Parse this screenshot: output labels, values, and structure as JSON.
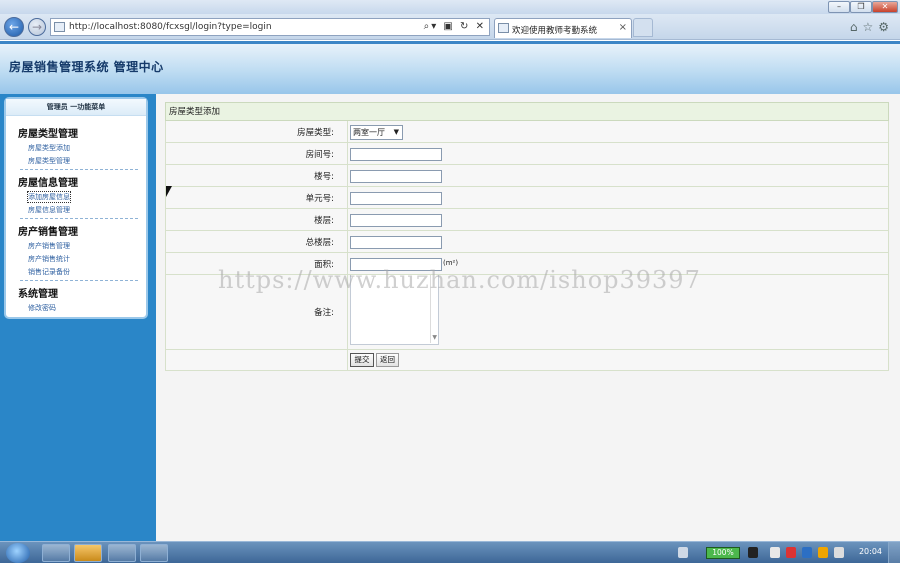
{
  "browser": {
    "url": "http://localhost:8080/fcxsgl/login?type=login",
    "tab_title": "欢迎使用教师考勤系统"
  },
  "app": {
    "title": "房屋销售管理系统  管理中心"
  },
  "sidebar": {
    "header": "管理员 一功能菜单",
    "groups": [
      {
        "title": "房屋类型管理",
        "items": [
          "房屋类型添加",
          "房屋类型管理"
        ]
      },
      {
        "title": "房屋信息管理",
        "items": [
          "添加房屋信息",
          "房屋信息管理"
        ]
      },
      {
        "title": "房产销售管理",
        "items": [
          "房产销售管理",
          "房产销售统计",
          "销售记录备份"
        ]
      },
      {
        "title": "系统管理",
        "items": [
          "修改密码"
        ]
      }
    ]
  },
  "form": {
    "title": "房屋类型添加",
    "fields": {
      "house_type": {
        "label": "房屋类型:",
        "value": "两室一厅"
      },
      "room_no": {
        "label": "房间号:",
        "value": ""
      },
      "building_no": {
        "label": "楼号:",
        "value": ""
      },
      "unit_no": {
        "label": "单元号:",
        "value": ""
      },
      "floor": {
        "label": "楼层:",
        "value": ""
      },
      "total_floors": {
        "label": "总楼层:",
        "value": ""
      },
      "area": {
        "label": "面积:",
        "value": "",
        "unit": "(m²)"
      },
      "remarks": {
        "label": "备注:"
      }
    },
    "submit_label": "提交",
    "back_label": "返回"
  },
  "watermark": "https://www.huzhan.com/ishop39397",
  "taskbar": {
    "battery": "100%",
    "clock": "20:04"
  }
}
